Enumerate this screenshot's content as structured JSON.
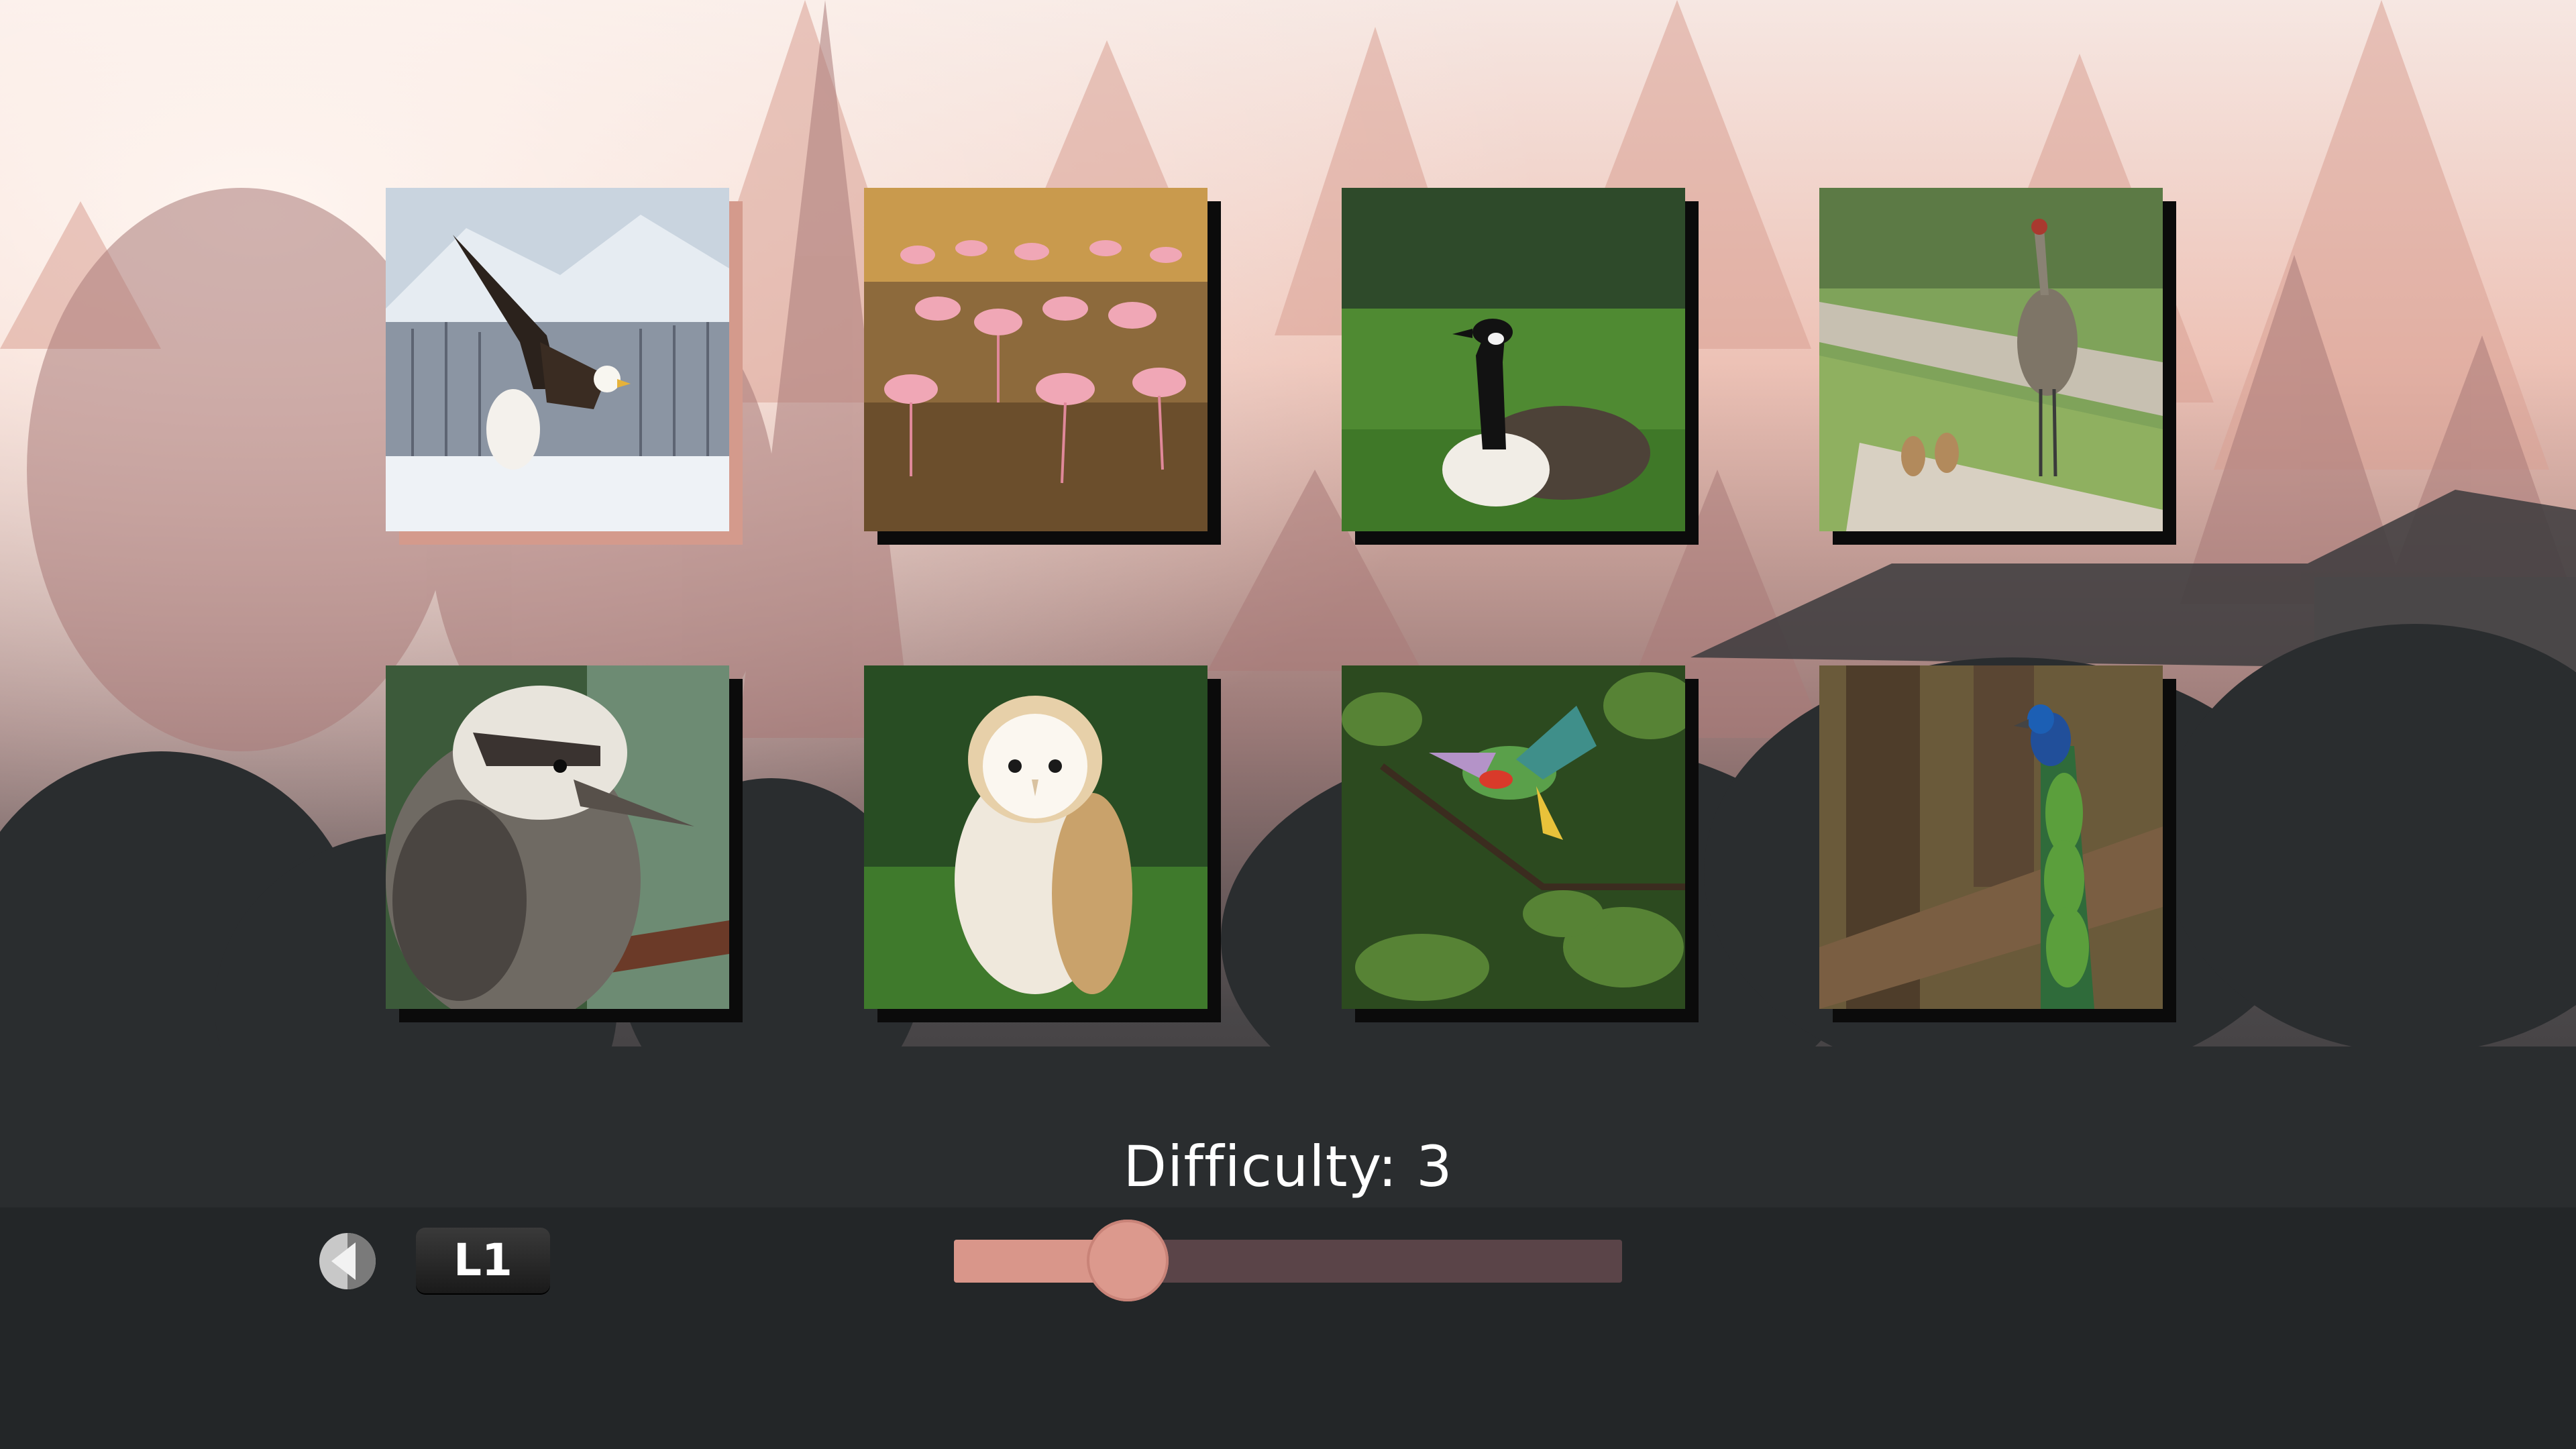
{
  "difficulty": {
    "label": "Difficulty: 3",
    "value": 3,
    "min": 1,
    "max": 10,
    "fill_fraction": 0.26
  },
  "controls": {
    "prev_button_label": "L1",
    "prev_icon": "left-arrow-circle-icon"
  },
  "colors": {
    "accent": "#d9968a",
    "track": "#5a4448",
    "selected_frame": "#d49a8c"
  },
  "tiles": [
    {
      "id": "eagle",
      "name": "eagle-photo",
      "selected": true
    },
    {
      "id": "flamingo",
      "name": "flamingo-photo",
      "selected": false
    },
    {
      "id": "goose",
      "name": "goose-photo",
      "selected": false
    },
    {
      "id": "crane",
      "name": "crane-photo",
      "selected": false
    },
    {
      "id": "kookaburra",
      "name": "kookaburra-photo",
      "selected": false
    },
    {
      "id": "owl",
      "name": "owl-photo",
      "selected": false
    },
    {
      "id": "parrot",
      "name": "parrot-photo",
      "selected": false
    },
    {
      "id": "peacock",
      "name": "peacock-photo",
      "selected": false
    }
  ]
}
